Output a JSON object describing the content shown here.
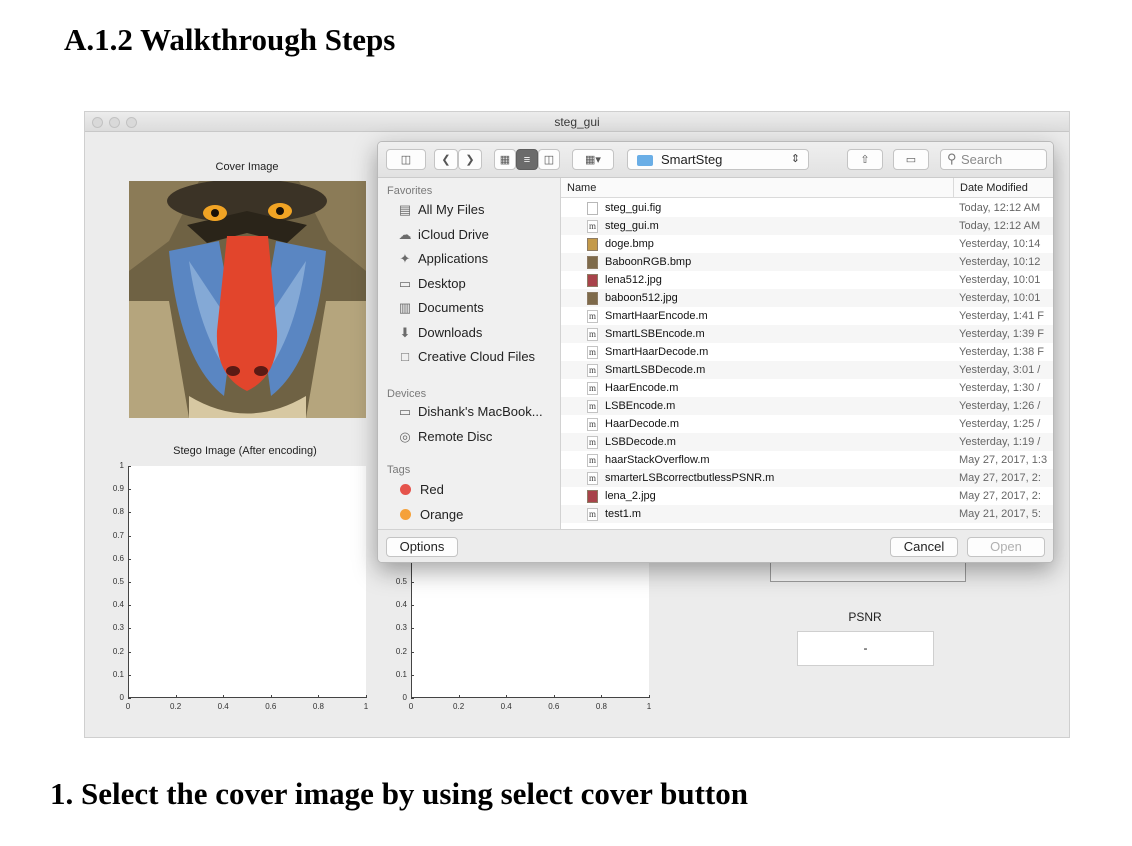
{
  "document": {
    "heading": "A.1.2 Walkthrough Steps",
    "caption": "1. Select the cover image by using select cover button"
  },
  "window": {
    "title": "steg_gui",
    "cover_label": "Cover Image",
    "stego_label": "Stego Image (After encoding)",
    "psnr_label": "PSNR",
    "psnr_value": "-",
    "stego_axes": {
      "y_ticks": [
        "1",
        "0.9",
        "0.8",
        "0.7",
        "0.6",
        "0.5",
        "0.4",
        "0.3",
        "0.2",
        "0.1",
        "0"
      ],
      "x_ticks": [
        "0",
        "0.2",
        "0.4",
        "0.6",
        "0.8",
        "1"
      ]
    },
    "second_axes": {
      "y_ticks": [
        "0.5",
        "0.4",
        "0.3",
        "0.2",
        "0.1",
        "0"
      ],
      "x_ticks": [
        "0",
        "0.2",
        "0.4",
        "0.6",
        "0.8",
        "1"
      ]
    }
  },
  "dialog": {
    "current_folder": "SmartSteg",
    "search_placeholder": "Search",
    "sidebar": {
      "favorites_header": "Favorites",
      "favorites": [
        {
          "label": "All My Files",
          "icon": "all-files-icon"
        },
        {
          "label": "iCloud Drive",
          "icon": "cloud-icon"
        },
        {
          "label": "Applications",
          "icon": "applications-icon"
        },
        {
          "label": "Desktop",
          "icon": "desktop-icon"
        },
        {
          "label": "Documents",
          "icon": "documents-icon"
        },
        {
          "label": "Downloads",
          "icon": "downloads-icon"
        },
        {
          "label": "Creative Cloud Files",
          "icon": "folder-icon"
        }
      ],
      "devices_header": "Devices",
      "devices": [
        {
          "label": "Dishank's MacBook...",
          "icon": "laptop-icon"
        },
        {
          "label": "Remote Disc",
          "icon": "disc-icon"
        }
      ],
      "tags_header": "Tags",
      "tags": [
        {
          "label": "Red",
          "color": "#e5534b"
        },
        {
          "label": "Orange",
          "color": "#f5a13a"
        }
      ]
    },
    "columns": {
      "name": "Name",
      "date": "Date Modified"
    },
    "files": [
      {
        "name": "steg_gui.fig",
        "date": "Today, 12:12 AM",
        "type": "doc"
      },
      {
        "name": "steg_gui.m",
        "date": "Today, 12:12 AM",
        "type": "m"
      },
      {
        "name": "doge.bmp",
        "date": "Yesterday, 10:14",
        "type": "img",
        "color": "#c49a4a"
      },
      {
        "name": "BaboonRGB.bmp",
        "date": "Yesterday, 10:12",
        "type": "img",
        "color": "#7e6a4a"
      },
      {
        "name": "lena512.jpg",
        "date": "Yesterday, 10:01",
        "type": "img",
        "color": "#a8434a"
      },
      {
        "name": "baboon512.jpg",
        "date": "Yesterday, 10:01",
        "type": "img",
        "color": "#7e6a4a"
      },
      {
        "name": "SmartHaarEncode.m",
        "date": "Yesterday, 1:41 F",
        "type": "m"
      },
      {
        "name": "SmartLSBEncode.m",
        "date": "Yesterday, 1:39 F",
        "type": "m"
      },
      {
        "name": "SmartHaarDecode.m",
        "date": "Yesterday, 1:38 F",
        "type": "m"
      },
      {
        "name": "SmartLSBDecode.m",
        "date": "Yesterday, 3:01 /",
        "type": "m"
      },
      {
        "name": "HaarEncode.m",
        "date": "Yesterday, 1:30 /",
        "type": "m"
      },
      {
        "name": "LSBEncode.m",
        "date": "Yesterday, 1:26 /",
        "type": "m"
      },
      {
        "name": "HaarDecode.m",
        "date": "Yesterday, 1:25 /",
        "type": "m"
      },
      {
        "name": "LSBDecode.m",
        "date": "Yesterday, 1:19 /",
        "type": "m"
      },
      {
        "name": "haarStackOverflow.m",
        "date": "May 27, 2017, 1:3",
        "type": "m"
      },
      {
        "name": "smarterLSBcorrectbutlessPSNR.m",
        "date": "May 27, 2017, 2:",
        "type": "m"
      },
      {
        "name": "lena_2.jpg",
        "date": "May 27, 2017, 2:",
        "type": "img",
        "color": "#a8434a"
      },
      {
        "name": "test1.m",
        "date": "May 21, 2017, 5:",
        "type": "m"
      }
    ],
    "options_label": "Options",
    "cancel_label": "Cancel",
    "open_label": "Open"
  }
}
